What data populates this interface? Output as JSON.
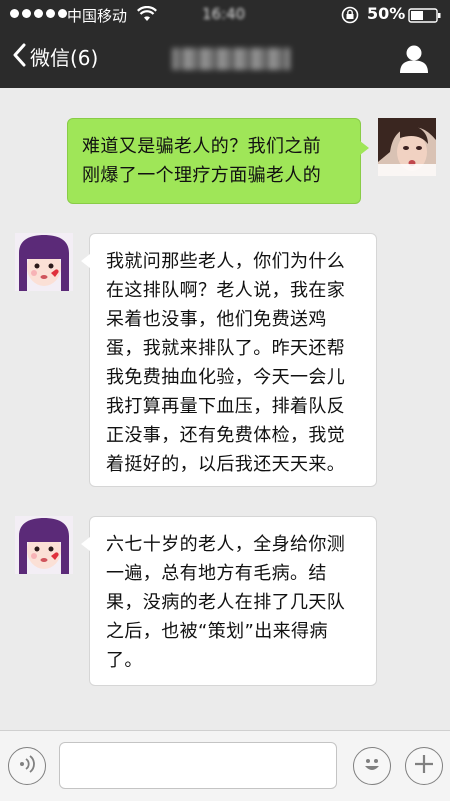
{
  "status_bar": {
    "carrier": "中国移动",
    "time": "16:40",
    "battery": "50%",
    "icons": [
      "signal-dots",
      "wifi-icon",
      "rotation-lock-icon",
      "battery-icon"
    ]
  },
  "nav": {
    "back_label": "微信(6)",
    "title_obscured": true,
    "right_icon": "person-icon"
  },
  "messages": [
    {
      "side": "right",
      "avatar": "photo-avatar",
      "lines": [
        "难道又是骗老人的？我们之前",
        "刚爆了一个理疗方面骗老人的"
      ]
    },
    {
      "side": "left",
      "avatar": "cartoon-girl-avatar",
      "lines": [
        "我就问那些老人，你们为什么",
        "在这排队啊？老人说，我在家",
        "呆着也没事，他们免费送鸡",
        "蛋，我就来排队了。昨天还帮",
        "我免费抽血化验，今天一会儿",
        "我打算再量下血压，排着队反",
        "正没事，还有免费体检，我觉",
        "着挺好的，以后我还天天来。"
      ]
    },
    {
      "side": "left",
      "avatar": "cartoon-girl-avatar",
      "lines": [
        "六七十岁的老人，全身给你测",
        "一遍，总有地方有毛病。结",
        "果，没病的老人在排了几天队",
        "之后，也被“策划”出来得病",
        "了。"
      ]
    }
  ],
  "input_bar": {
    "value": "",
    "left_icon": "voice-icon",
    "right_icons": [
      "emoji-icon",
      "plus-icon"
    ]
  },
  "colors": {
    "bar_bg": "#2b2b2b",
    "chat_bg": "#ebebeb",
    "out_bubble": "#9fe658",
    "in_bubble": "#ffffff"
  }
}
